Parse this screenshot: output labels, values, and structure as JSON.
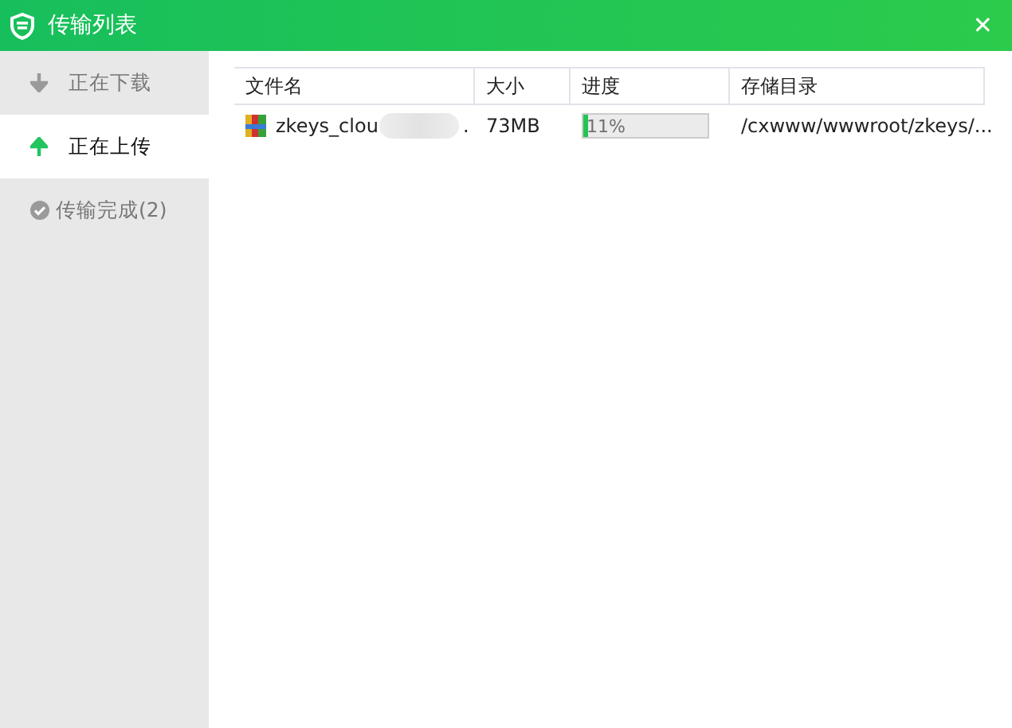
{
  "window": {
    "title": "传输列表",
    "close": "✕"
  },
  "sidebar": {
    "items": [
      {
        "label": "正在下载",
        "kind": "download",
        "selected": false
      },
      {
        "label": "正在上传",
        "kind": "upload",
        "selected": true
      },
      {
        "label": "传输完成(2)",
        "kind": "done",
        "selected": false
      }
    ]
  },
  "table": {
    "columns": [
      "文件名",
      "大小",
      "进度",
      "存储目录"
    ],
    "rows": [
      {
        "name": "zkeys_clou",
        "name_tail": ".",
        "size": "73MB",
        "progress": "11%",
        "level": 0.04,
        "path": "/cxwww/wwwroot/zkeys/..."
      }
    ]
  }
}
